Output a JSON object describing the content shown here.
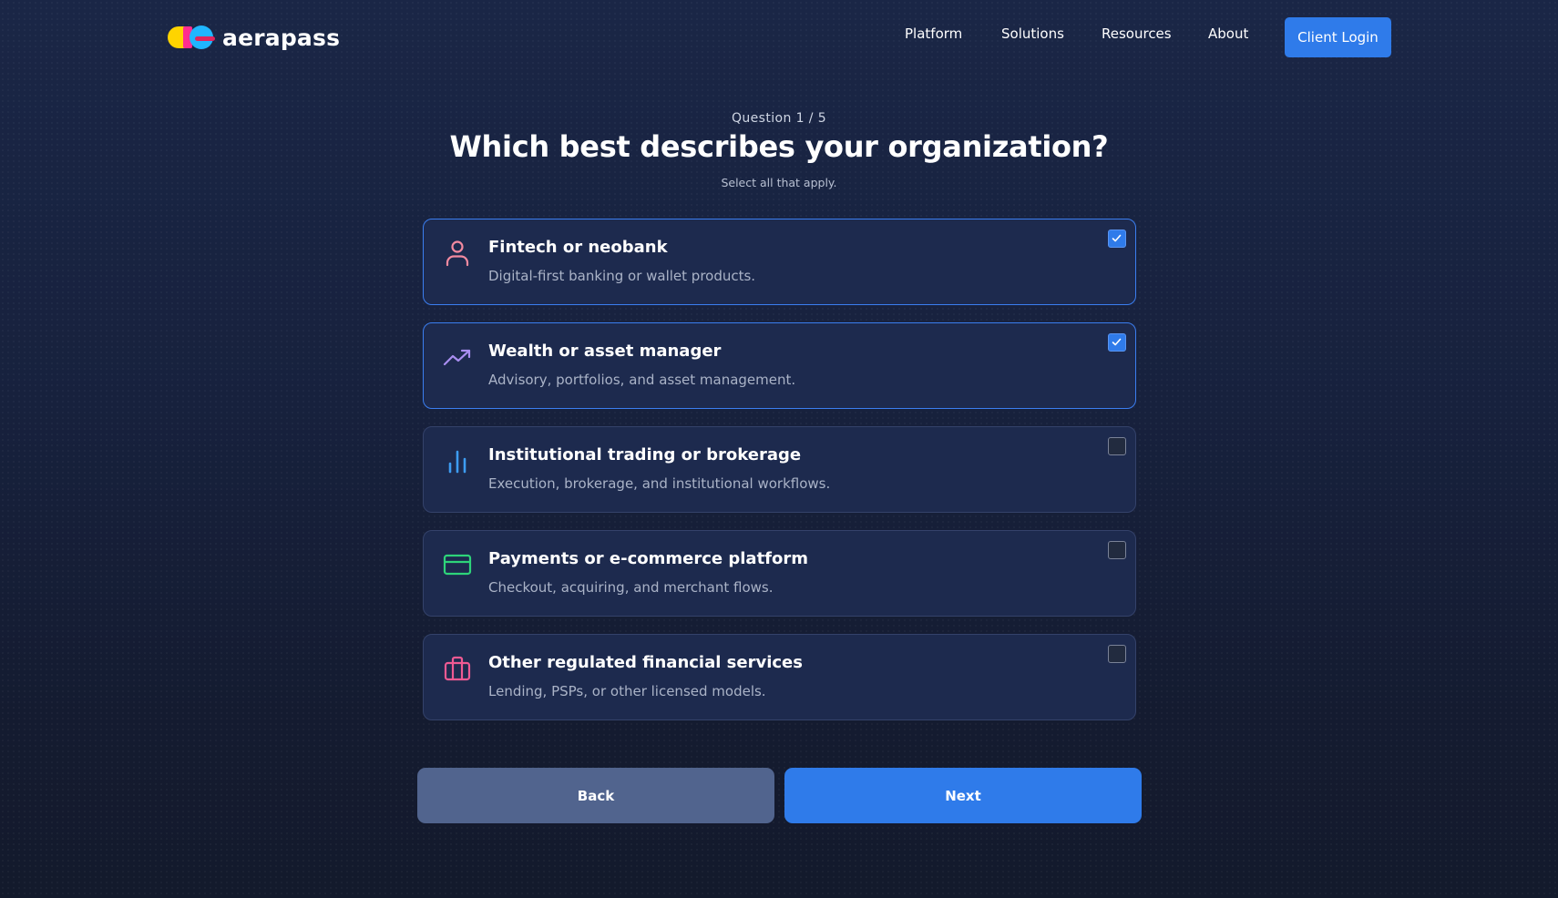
{
  "header": {
    "brand": "aerapass",
    "nav": [
      {
        "label": "Platform"
      },
      {
        "label": "Solutions"
      },
      {
        "label": "Resources"
      },
      {
        "label": "About"
      }
    ],
    "login_label": "Client Login"
  },
  "question": {
    "progress": "Question 1 / 5",
    "title": "Which best describes your organization?",
    "subtitle": "Select all that apply."
  },
  "options": [
    {
      "title": "Fintech or neobank",
      "description": "Digital-first banking or wallet products.",
      "icon": "user-icon",
      "selected": true
    },
    {
      "title": "Wealth or asset manager",
      "description": "Advisory, portfolios, and asset management.",
      "icon": "trending-up-icon",
      "selected": true
    },
    {
      "title": "Institutional trading or brokerage",
      "description": "Execution, brokerage, and institutional workflows.",
      "icon": "bar-chart-icon",
      "selected": false
    },
    {
      "title": "Payments or e-commerce platform",
      "description": "Checkout, acquiring, and merchant flows.",
      "icon": "credit-card-icon",
      "selected": false
    },
    {
      "title": "Other regulated financial services",
      "description": "Lending, PSPs, or other licensed models.",
      "icon": "briefcase-icon",
      "selected": false
    }
  ],
  "actions": {
    "back_label": "Back",
    "next_label": "Next"
  },
  "colors": {
    "accent": "#2f7bea",
    "back_button": "#51648e",
    "card_background": "#1d2a4e"
  }
}
